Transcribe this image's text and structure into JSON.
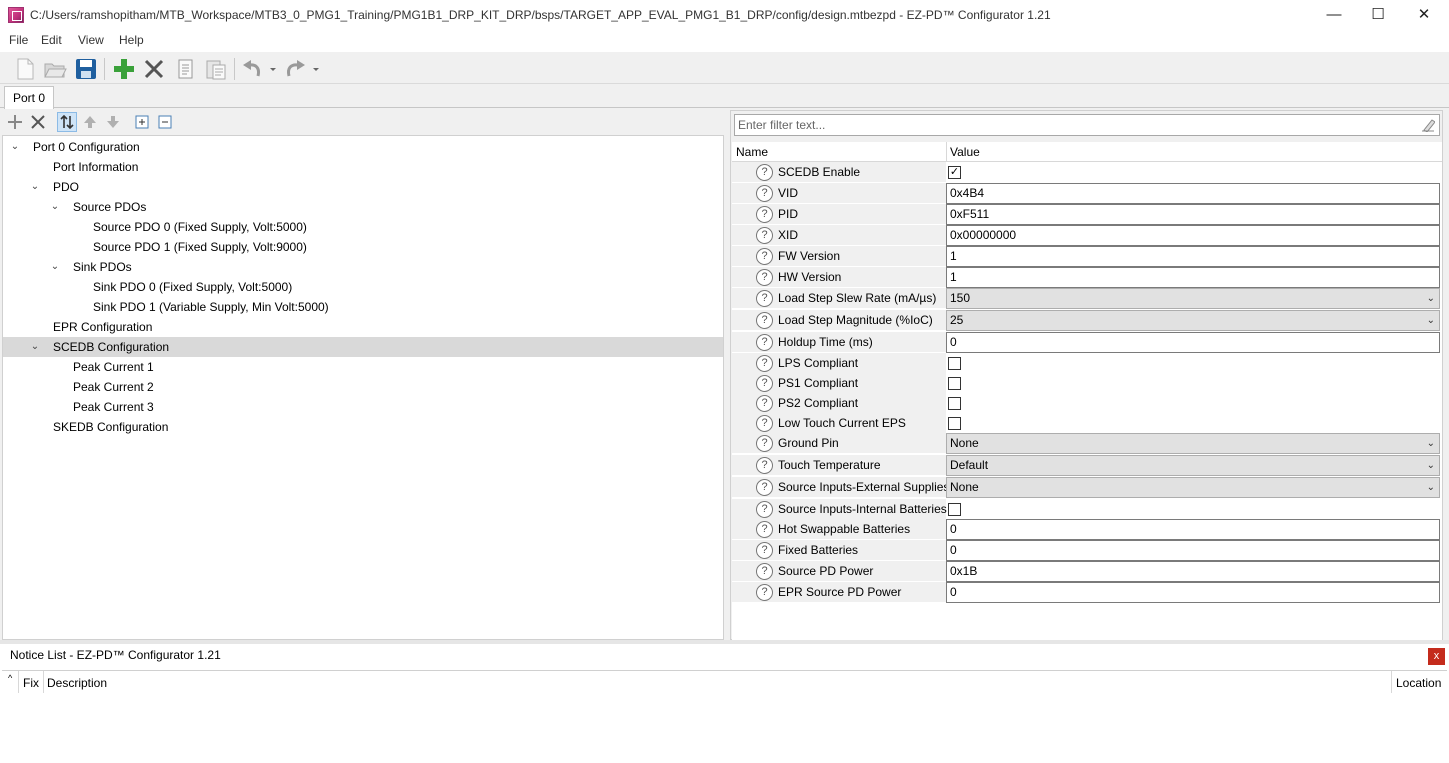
{
  "window": {
    "title": "C:/Users/ramshopitham/MTB_Workspace/MTB3_0_PMG1_Training/PMG1B1_DRP_KIT_DRP/bsps/TARGET_APP_EVAL_PMG1_B1_DRP/config/design.mtbezpd - EZ-PD™ Configurator 1.21",
    "minimize": "—",
    "maximize": "☐",
    "close": "✕"
  },
  "menu": [
    "File",
    "Edit",
    "View",
    "Help"
  ],
  "tabs": [
    {
      "label": "Port 0"
    }
  ],
  "filter": {
    "placeholder": "Enter filter text..."
  },
  "tree": [
    {
      "label": "Port 0 Configuration",
      "depth": 0,
      "expanded": true
    },
    {
      "label": "Port Information",
      "depth": 1
    },
    {
      "label": "PDO",
      "depth": 1,
      "expanded": true
    },
    {
      "label": "Source PDOs",
      "depth": 2,
      "expanded": true
    },
    {
      "label": "Source PDO 0 (Fixed Supply, Volt:5000)",
      "depth": 3
    },
    {
      "label": "Source PDO 1 (Fixed Supply, Volt:9000)",
      "depth": 3
    },
    {
      "label": "Sink PDOs",
      "depth": 2,
      "expanded": true
    },
    {
      "label": "Sink PDO 0 (Fixed Supply, Volt:5000)",
      "depth": 3
    },
    {
      "label": "Sink PDO 1 (Variable Supply, Min Volt:5000)",
      "depth": 3
    },
    {
      "label": "EPR Configuration",
      "depth": 1
    },
    {
      "label": "SCEDB Configuration",
      "depth": 1,
      "expanded": true,
      "selected": true
    },
    {
      "label": "Peak Current 1",
      "depth": 2
    },
    {
      "label": "Peak Current 2",
      "depth": 2
    },
    {
      "label": "Peak Current 3",
      "depth": 2
    },
    {
      "label": "SKEDB Configuration",
      "depth": 1
    }
  ],
  "grid": {
    "header": {
      "name": "Name",
      "value": "Value"
    },
    "rows": [
      {
        "name": "SCEDB Enable",
        "type": "check",
        "checked": true
      },
      {
        "name": "VID",
        "type": "text",
        "value": "0x4B4"
      },
      {
        "name": "PID",
        "type": "text",
        "value": "0xF511"
      },
      {
        "name": "XID",
        "type": "text",
        "value": "0x00000000"
      },
      {
        "name": "FW Version",
        "type": "text",
        "value": "1"
      },
      {
        "name": "HW Version",
        "type": "text",
        "value": "1"
      },
      {
        "name": "Load Step Slew Rate (mA/µs)",
        "type": "select",
        "value": "150"
      },
      {
        "name": "Load Step Magnitude (%IoC)",
        "type": "select",
        "value": "25"
      },
      {
        "name": "Holdup Time (ms)",
        "type": "text",
        "value": "0"
      },
      {
        "name": "LPS Compliant",
        "type": "check",
        "checked": false
      },
      {
        "name": "PS1 Compliant",
        "type": "check",
        "checked": false
      },
      {
        "name": "PS2 Compliant",
        "type": "check",
        "checked": false
      },
      {
        "name": "Low Touch Current EPS",
        "type": "check",
        "checked": false
      },
      {
        "name": "Ground Pin",
        "type": "select",
        "value": "None"
      },
      {
        "name": "Touch Temperature",
        "type": "select",
        "value": "Default"
      },
      {
        "name": "Source Inputs-External Supplies",
        "type": "select",
        "value": "None"
      },
      {
        "name": "Source Inputs-Internal Batteries",
        "type": "check",
        "checked": false
      },
      {
        "name": "Hot Swappable Batteries",
        "type": "text",
        "value": "0"
      },
      {
        "name": "Fixed Batteries",
        "type": "text",
        "value": "0"
      },
      {
        "name": "Source PD Power",
        "type": "text",
        "value": "0x1B"
      },
      {
        "name": "EPR Source PD Power",
        "type": "text",
        "value": "0"
      }
    ]
  },
  "notice": {
    "title": "Notice List - EZ-PD™ Configurator 1.21",
    "close": "x",
    "columns": {
      "fix": "Fix",
      "description": "Description",
      "location": "Location"
    }
  },
  "icons": {
    "question": "?",
    "chevron_down": "⌄",
    "dropdown_arrow": "⌄",
    "check": "✓"
  },
  "colors": {
    "accent_green": "#3aa13a",
    "selection_gray": "#d9d9d9",
    "close_red": "#c42b1c"
  }
}
